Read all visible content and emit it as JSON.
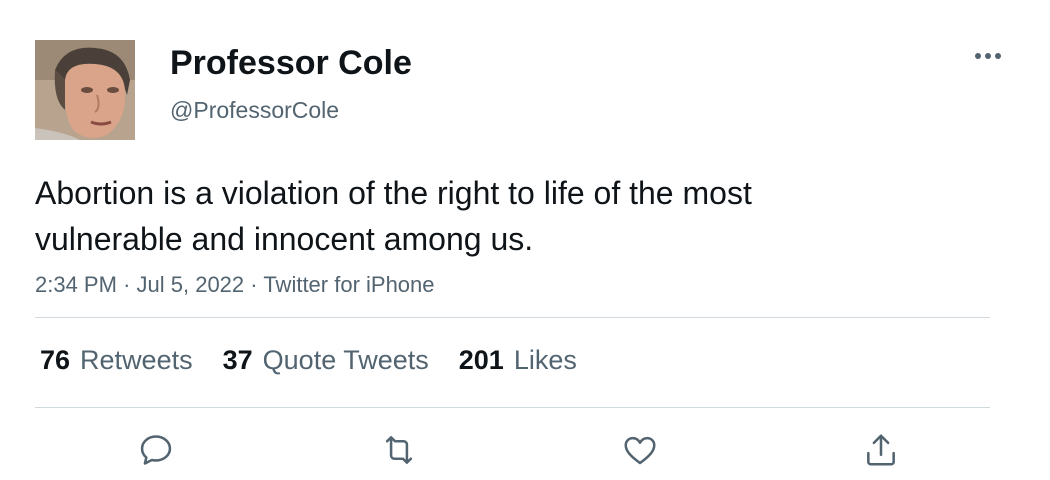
{
  "tweet": {
    "author": {
      "display_name": "Professor Cole",
      "handle": "@ProfessorCole"
    },
    "text": "Abortion is a violation of the right to life of the most vulnerable and innocent among us.",
    "meta": {
      "time": "2:34 PM",
      "date": "Jul 5, 2022",
      "source": "Twitter for iPhone",
      "separator": "·"
    },
    "stats": {
      "retweets": {
        "count": "76",
        "label": "Retweets"
      },
      "quote_tweets": {
        "count": "37",
        "label": "Quote Tweets"
      },
      "likes": {
        "count": "201",
        "label": "Likes"
      }
    }
  },
  "icons": {
    "more": "more-horizontal-icon",
    "reply": "reply-icon",
    "retweet": "retweet-icon",
    "like": "heart-icon",
    "share": "share-icon"
  },
  "colors": {
    "text_primary": "#0f1419",
    "text_secondary": "#536471",
    "divider": "#cfd9de",
    "background": "#ffffff"
  }
}
